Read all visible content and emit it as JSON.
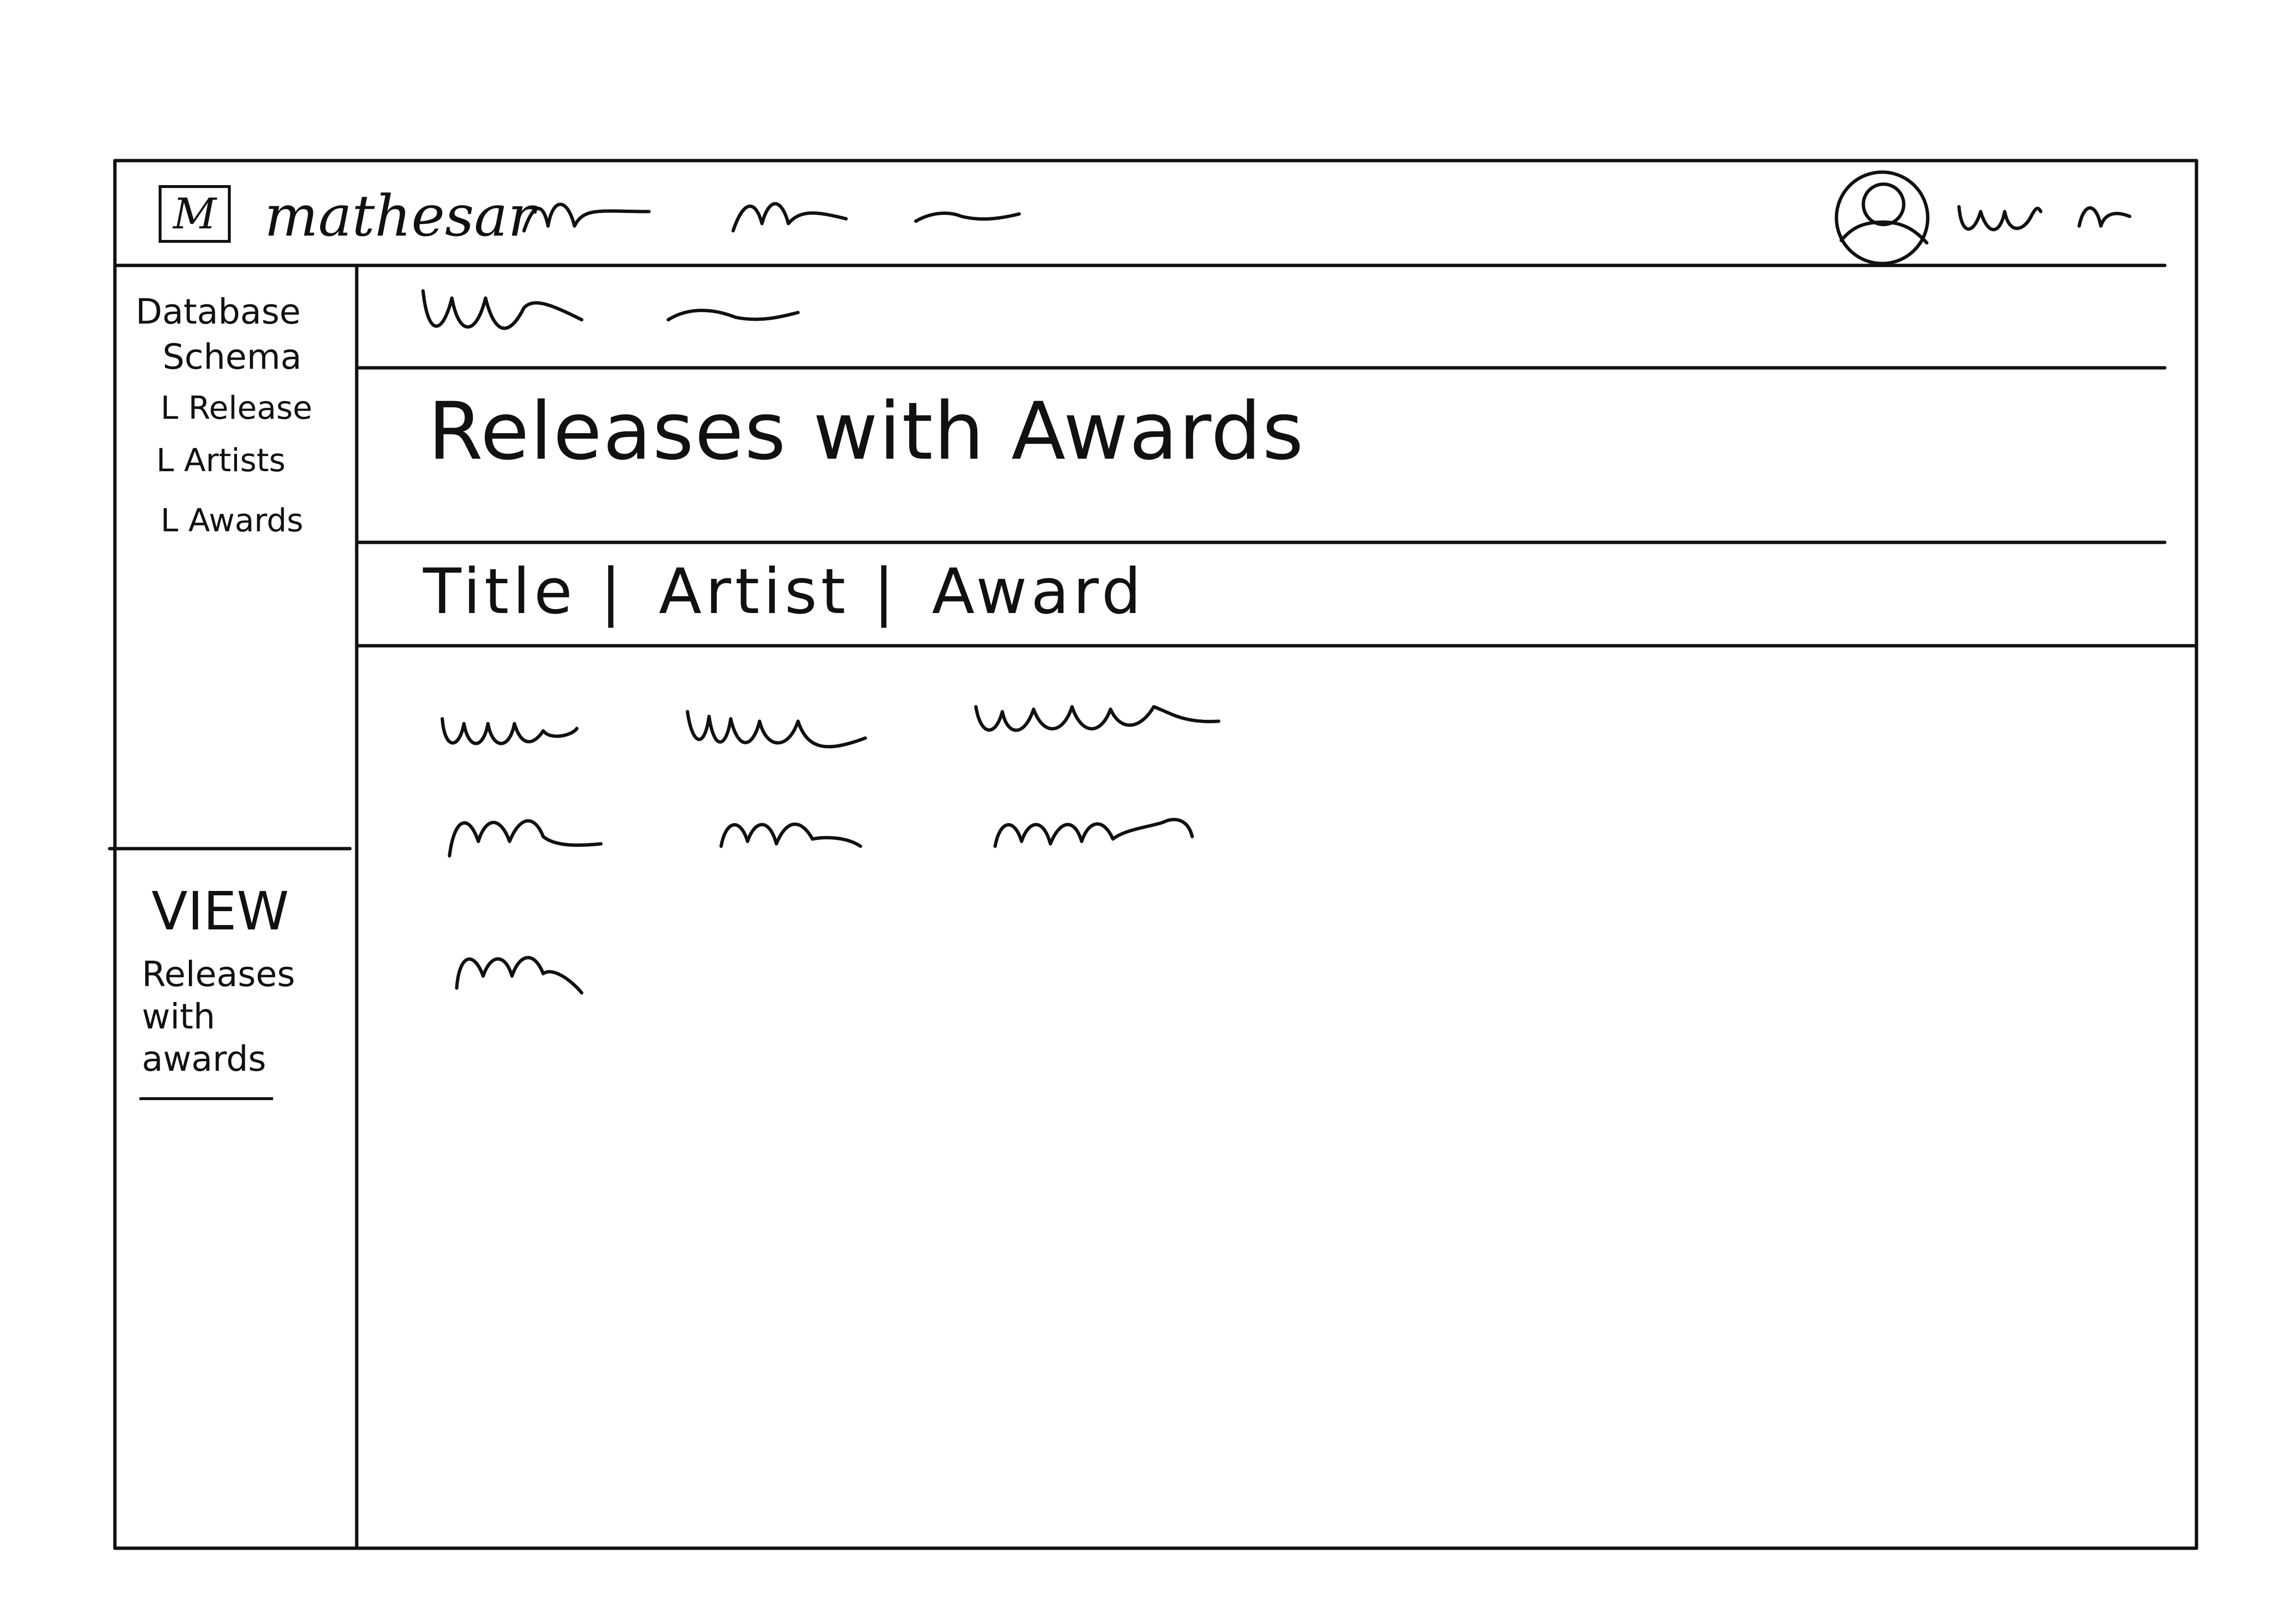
{
  "app": {
    "logo_letter": "M",
    "name": "mathesar"
  },
  "sidebar": {
    "database_label": "Database",
    "schema_label": "Schema",
    "tables": [
      {
        "label": "L Release"
      },
      {
        "label": "L Artists"
      },
      {
        "label": "L Awards"
      }
    ],
    "view_section_label": "VIEW",
    "view_item_label_lines": [
      "Releases",
      "with",
      "awards"
    ]
  },
  "main": {
    "page_title": "Releases with Awards",
    "column_headers": [
      "Title",
      "Artist",
      "Award"
    ],
    "column_separator": "|"
  },
  "icons": {
    "user": "user-icon"
  }
}
